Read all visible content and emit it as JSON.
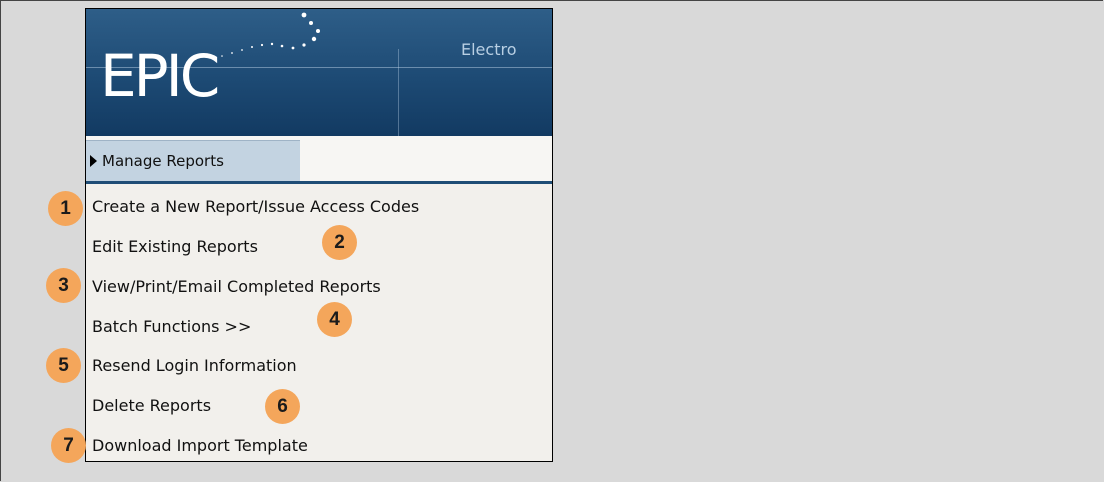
{
  "header": {
    "logo_text": "EPIC",
    "subtitle_text": "Electro"
  },
  "tab": {
    "label": "Manage Reports"
  },
  "menu": {
    "items": [
      {
        "label": "Create a New Report/Issue Access Codes",
        "badge": "1"
      },
      {
        "label": "Edit Existing Reports",
        "badge": "2"
      },
      {
        "label": "View/Print/Email Completed Reports",
        "badge": "3"
      },
      {
        "label": "Batch Functions >>",
        "badge": "4"
      },
      {
        "label": "Resend Login Information",
        "badge": "5"
      },
      {
        "label": "Delete Reports",
        "badge": "6"
      },
      {
        "label": "Download Import Template",
        "badge": "7"
      }
    ]
  },
  "colors": {
    "banner": "#1d4a74",
    "tab": "#c3d3e1",
    "badge": "#f4a65b"
  }
}
